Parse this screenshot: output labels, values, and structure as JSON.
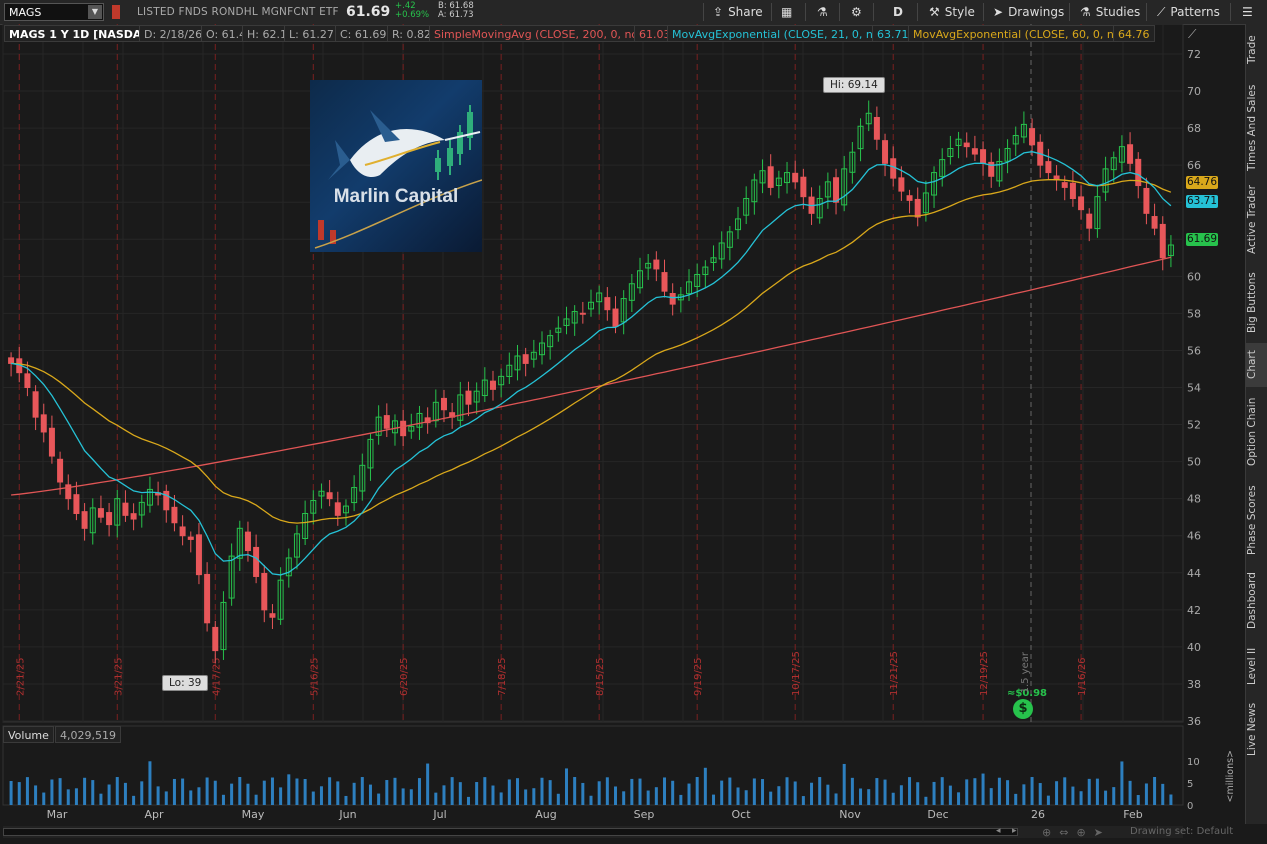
{
  "toolbar": {
    "symbol": "MAGS",
    "description": "LISTED FNDS RONDHL MGNFCNT ETF",
    "last": "61.69",
    "change_abs": "+.42",
    "change_pct": "+0.69%",
    "bid": "B: 61.68",
    "ask": "A: 61.73",
    "share_label": "Share",
    "period_label": "D",
    "style_label": "Style",
    "drawings_label": "Drawings",
    "studies_label": "Studies",
    "patterns_label": "Patterns"
  },
  "legend": {
    "title": "MAGS 1 Y 1D [NASDAQ]",
    "date": "D: 2/18/26",
    "open": "O: 61.4",
    "high": "H: 62.1",
    "low": "L: 61.27",
    "close": "C: 61.69",
    "range": "R: 0.82",
    "sma_label": "SimpleMovingAvg (CLOSE, 200, 0, no)",
    "sma_value": "61.03",
    "ema21_label": "MovAvgExponential (CLOSE, 21, 0, no)",
    "ema21_value": "63.71",
    "ema60_label": "MovAvgExponential (CLOSE, 60, 0, no)",
    "ema60_value": "64.76"
  },
  "colors": {
    "up": "#27c24c",
    "down": "#e8575a",
    "sma200": "#e05555",
    "ema21": "#25c2d6",
    "ema60": "#d9a81b",
    "volume": "#2d7fbf"
  },
  "annotations": {
    "high_label": "Hi: 69.14",
    "low_label": "Lo: 39",
    "dividend_label": "≈$0.98",
    "dividend_icon": "dollar-circle-icon",
    "year_marker": "1.5 year"
  },
  "logo": {
    "text": "Marlin Capital",
    "icon": "marlin-fish-icon"
  },
  "price_axis": {
    "ticks": [
      "72",
      "70",
      "68",
      "66",
      "64",
      "62",
      "60",
      "58",
      "56",
      "54",
      "52",
      "50",
      "48",
      "46",
      "44",
      "42",
      "40",
      "38",
      "36"
    ],
    "ema60_tag": "64.76",
    "ema21_tag": "63.71",
    "last_tag": "61.69"
  },
  "volume": {
    "label": "Volume",
    "value": "4,029,519",
    "axis_ticks": [
      "10",
      "5",
      "0"
    ],
    "unit": "<millions>"
  },
  "time_axis": {
    "months": [
      "Mar",
      "Apr",
      "May",
      "Jun",
      "Jul",
      "Aug",
      "Sep",
      "Oct",
      "Nov",
      "Dec",
      "26",
      "Feb"
    ],
    "date_markers": [
      "2/21/25",
      "3/21/25",
      "4/17/25",
      "5/16/25",
      "6/20/25",
      "7/18/25",
      "8/15/25",
      "9/19/25",
      "10/17/25",
      "11/21/25",
      "12/19/25",
      "1/16/26"
    ]
  },
  "right_panel": {
    "tabs": [
      "Trade",
      "Times And Sales",
      "Active Trader",
      "Big Buttons",
      "Chart",
      "Option Chain",
      "Phase Scores",
      "Dashboard",
      "Level II",
      "Live News"
    ],
    "active": "Chart"
  },
  "footer": {
    "drawing_set": "Drawing set: Default"
  },
  "chart_data": {
    "type": "candlestick",
    "symbol": "MAGS",
    "ylim": [
      36,
      72
    ],
    "closes": [
      55.3,
      54.8,
      54.0,
      52.4,
      51.6,
      50.3,
      48.9,
      48.0,
      47.2,
      46.4,
      47.5,
      47.0,
      46.6,
      48.0,
      47.1,
      46.9,
      47.8,
      48.5,
      48.2,
      47.4,
      46.7,
      46.0,
      45.8,
      43.9,
      41.3,
      39.8,
      42.4,
      44.9,
      46.4,
      45.2,
      43.8,
      42.0,
      41.6,
      43.6,
      44.8,
      46.1,
      47.2,
      47.9,
      48.4,
      48.0,
      47.1,
      47.6,
      48.6,
      49.8,
      51.2,
      52.4,
      51.8,
      52.2,
      51.4,
      51.9,
      52.6,
      52.1,
      53.2,
      52.8,
      52.4,
      53.6,
      53.1,
      53.8,
      54.4,
      53.9,
      54.6,
      55.2,
      55.7,
      55.3,
      55.9,
      56.4,
      56.8,
      57.2,
      57.7,
      58.1,
      58.0,
      58.6,
      59.1,
      58.2,
      57.3,
      58.8,
      59.6,
      60.3,
      60.7,
      60.4,
      59.2,
      58.5,
      59.0,
      59.7,
      60.1,
      60.5,
      61.0,
      61.8,
      62.4,
      63.1,
      64.2,
      65.2,
      65.7,
      64.8,
      65.3,
      65.6,
      65.1,
      64.3,
      63.4,
      64.2,
      65.1,
      64.0,
      65.8,
      66.7,
      68.1,
      68.8,
      67.4,
      66.1,
      65.3,
      64.6,
      64.1,
      63.2,
      64.5,
      65.6,
      66.3,
      66.9,
      67.4,
      67.0,
      66.6,
      66.1,
      65.4,
      66.2,
      66.9,
      67.6,
      68.2,
      67.1,
      66.0,
      65.6,
      65.2,
      64.8,
      64.2,
      63.6,
      62.6,
      64.3,
      65.8,
      66.4,
      67.0,
      66.1,
      64.9,
      63.4,
      62.6,
      61.0,
      61.69
    ]
  }
}
